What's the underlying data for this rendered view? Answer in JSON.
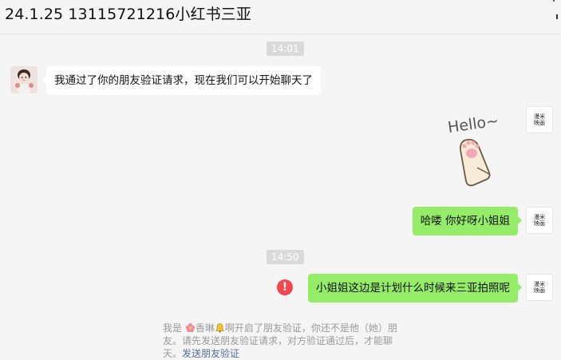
{
  "window": {
    "title": "24.1.25 13115721216小红书三亚"
  },
  "chat": {
    "timestamps": [
      "14:01",
      "14:50"
    ],
    "messages": [
      {
        "side": "left",
        "text": "我通过了你的朋友验证请求，现在我们可以开始聊天了"
      },
      {
        "side": "right",
        "type": "sticker",
        "sticker_text": "Hello~"
      },
      {
        "side": "right",
        "text": "哈喽 你好呀小姐姐"
      },
      {
        "side": "right",
        "text": "小姐姐这边是计划什么时候来三亚拍照呢",
        "status": "send-failed"
      }
    ],
    "brand_avatar_text": [
      "漫米",
      "映画"
    ]
  },
  "system_note": {
    "prefix": "我是",
    "name": "香琳",
    "middle": "啊开启了朋友验证，你还不是他（她）朋友。请先发送朋友验证请求，对方验证通过后，才能聊天。",
    "link": "发送朋友验证"
  },
  "colors": {
    "bubble_green": "#95ec69",
    "bubble_white": "#ffffff",
    "error_red": "#f2474f",
    "link_blue": "#576b95"
  }
}
